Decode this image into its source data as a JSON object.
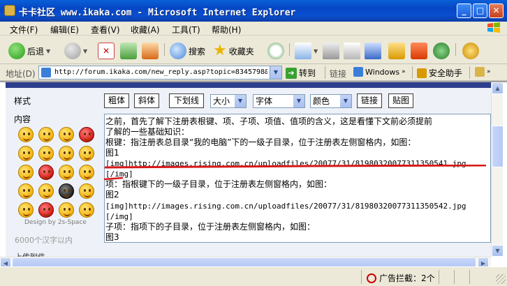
{
  "window": {
    "title": "卡卡社区 www.ikaka.com - Microsoft Internet Explorer"
  },
  "menu": [
    "文件(F)",
    "编辑(E)",
    "查看(V)",
    "收藏(A)",
    "工具(T)",
    "帮助(H)"
  ],
  "toolbar": {
    "back": "后退",
    "search": "搜索",
    "favorites": "收藏夹"
  },
  "address": {
    "label": "地址(D)",
    "url": "http://forum.ikaka.com/new_reply.asp?topic=8345798&",
    "go": "转到",
    "links": "链接",
    "link_windows": "Windows",
    "safety": "安全助手"
  },
  "form": {
    "style_label": "样式",
    "content_label": "内容",
    "buttons": [
      "粗体",
      "斜体",
      "下划线"
    ],
    "selects": [
      "大小",
      "字体",
      "颜色"
    ],
    "link_button": "链接",
    "paste_button": "贴图",
    "design_credit": "Design by 2s-Space",
    "char_limit": "6000个汉字以内",
    "attachment_label": "上传附件"
  },
  "editor": {
    "lines": [
      "之前，首先了解下注册表根键、项、子项、项值、值项的含义，这是看懂下文前必须提前",
      "了解的一些基础知识：",
      "根键：指注册表总目录“我的电脑”下的一级子目录，位于注册表左侧窗格内，如图：",
      "图1",
      "[img]http://images.rising.com.cn/uploadfiles/20077/31/81980320077311350541.jpg",
      "[/img]",
      "项：指根键下的一级子目录，位于注册表左侧窗格内，如图：",
      "图2",
      "[img]http://images.rising.com.cn/uploadfiles/20077/31/81980320077311350542.jpg",
      "[/img]",
      "子项：指项下的子目录，位于注册表左侧窗格内，如图：",
      "图3"
    ]
  },
  "status": {
    "popup_blocked": "广告拦截：2个"
  },
  "colors": {
    "title_bar": "#0546c4",
    "annotation_red": "#d81818"
  }
}
